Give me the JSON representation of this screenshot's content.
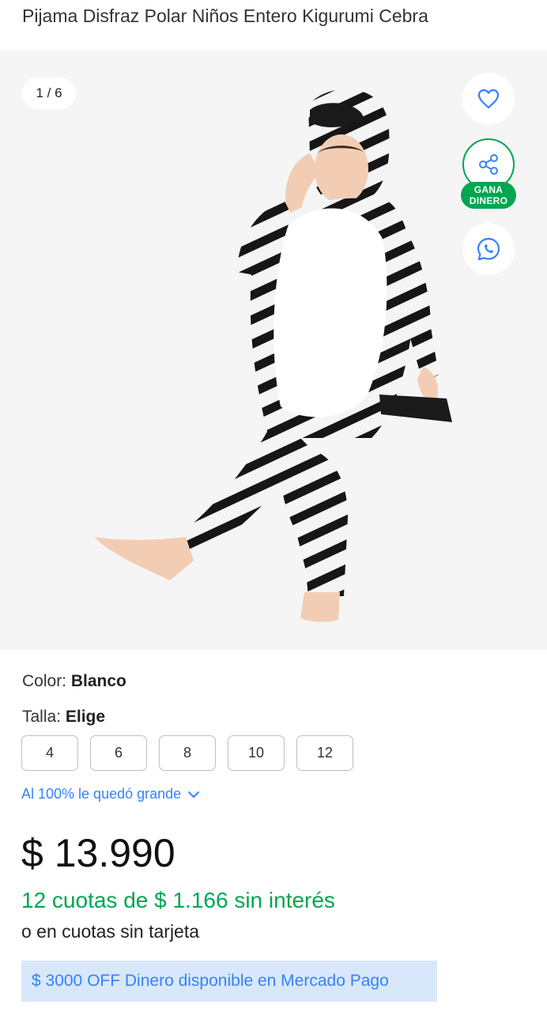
{
  "product": {
    "title": "Pijama Disfraz Polar Niños Entero Kigurumi Cebra"
  },
  "gallery": {
    "counter": "1 / 6",
    "badge_line1": "GANA",
    "badge_line2": "DINERO"
  },
  "attributes": {
    "color_label": "Color:",
    "color_value": "Blanco",
    "size_label": "Talla:",
    "size_value": "Elige",
    "sizes": [
      "4",
      "6",
      "8",
      "10",
      "12"
    ],
    "fit_note": "Al 100% le quedó grande"
  },
  "pricing": {
    "price": "$ 13.990",
    "installments": "12 cuotas de $ 1.166 sin interés",
    "alt_payment": "o en cuotas sin tarjeta",
    "promo": "$ 3000 OFF Dinero disponible en Mercado Pago"
  },
  "colors": {
    "accent_blue": "#3483fa",
    "accent_green": "#00a650",
    "promo_bg": "#d9e7fa"
  },
  "icons": {
    "favorite": "heart-icon",
    "share": "share-icon",
    "whatsapp": "whatsapp-icon",
    "chevron": "chevron-down-icon"
  }
}
